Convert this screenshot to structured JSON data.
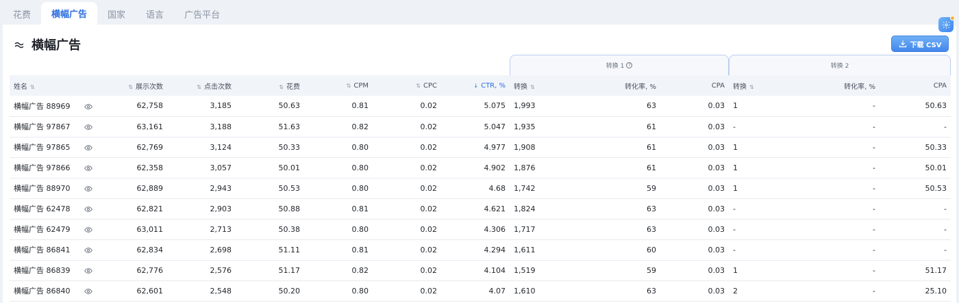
{
  "tabs": [
    "花费",
    "横幅广告",
    "国家",
    "语言",
    "广告平台"
  ],
  "active_tab": "横幅广告",
  "page_title": "横幅广告",
  "download_button": "下载 CSV",
  "groups": {
    "conv1": "转换 1",
    "conv2": "转换 2"
  },
  "columns": {
    "name": "姓名",
    "impressions": "展示次数",
    "clicks": "点击次数",
    "spend": "花费",
    "cpm": "CPM",
    "cpc": "CPC",
    "ctr": "CTR, %",
    "conv1": "转换",
    "rate1": "转化率, %",
    "cpa1": "CPA",
    "conv2": "转换",
    "rate2": "转化率, %",
    "cpa2": "CPA"
  },
  "rows": [
    [
      "横幅广告 88969",
      "62,758",
      "3,185",
      "50.63",
      "0.81",
      "0.02",
      "5.075",
      "1,993",
      "63",
      "0.03",
      "1",
      "-",
      "50.63"
    ],
    [
      "横幅广告 97867",
      "63,161",
      "3,188",
      "51.63",
      "0.82",
      "0.02",
      "5.047",
      "1,935",
      "61",
      "0.03",
      "-",
      "-",
      "-"
    ],
    [
      "横幅广告 97865",
      "62,769",
      "3,124",
      "50.33",
      "0.80",
      "0.02",
      "4.977",
      "1,908",
      "61",
      "0.03",
      "1",
      "-",
      "50.33"
    ],
    [
      "横幅广告 97866",
      "62,358",
      "3,057",
      "50.01",
      "0.80",
      "0.02",
      "4.902",
      "1,876",
      "61",
      "0.03",
      "1",
      "-",
      "50.01"
    ],
    [
      "横幅广告 88970",
      "62,889",
      "2,943",
      "50.53",
      "0.80",
      "0.02",
      "4.68",
      "1,742",
      "59",
      "0.03",
      "1",
      "-",
      "50.53"
    ],
    [
      "横幅广告 62478",
      "62,821",
      "2,903",
      "50.88",
      "0.81",
      "0.02",
      "4.621",
      "1,824",
      "63",
      "0.03",
      "-",
      "-",
      "-"
    ],
    [
      "横幅广告 62479",
      "63,011",
      "2,713",
      "50.38",
      "0.80",
      "0.02",
      "4.306",
      "1,717",
      "63",
      "0.03",
      "-",
      "-",
      "-"
    ],
    [
      "横幅广告 86841",
      "62,834",
      "2,698",
      "51.11",
      "0.81",
      "0.02",
      "4.294",
      "1,611",
      "60",
      "0.03",
      "-",
      "-",
      "-"
    ],
    [
      "横幅广告 86839",
      "62,776",
      "2,576",
      "51.17",
      "0.82",
      "0.02",
      "4.104",
      "1,519",
      "59",
      "0.03",
      "1",
      "-",
      "51.17"
    ],
    [
      "横幅广告 86840",
      "62,601",
      "2,548",
      "50.20",
      "0.80",
      "0.02",
      "4.07",
      "1,610",
      "63",
      "0.03",
      "2",
      "-",
      "25.10"
    ]
  ],
  "icons": {
    "title": "chart-wave-icon",
    "download": "download-icon",
    "settings": "gear-icon",
    "row_action": "eye-icon",
    "sort": "sort-arrows-icon",
    "sort_desc": "arrow-down-icon",
    "help": "question-icon"
  },
  "colors": {
    "accent": "#2d6fe0",
    "button": "#4387ec",
    "badge": "#f5b12b"
  }
}
